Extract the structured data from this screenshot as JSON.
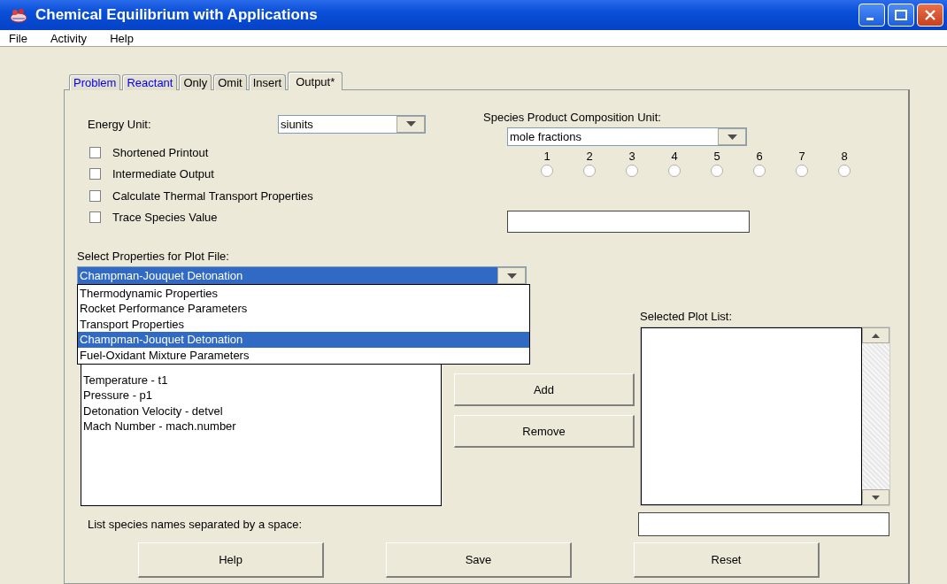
{
  "window": {
    "title": "Chemical Equilibrium with Applications"
  },
  "menu": [
    "File",
    "Activity",
    "Help"
  ],
  "tabs": [
    {
      "label": "Problem",
      "selected": false,
      "visited": true
    },
    {
      "label": "Reactant",
      "selected": false,
      "visited": true
    },
    {
      "label": "Only",
      "selected": false,
      "visited": false
    },
    {
      "label": "Omit",
      "selected": false,
      "visited": false
    },
    {
      "label": "Insert",
      "selected": false,
      "visited": false
    },
    {
      "label": "Output*",
      "selected": true,
      "visited": false
    }
  ],
  "energy_unit": {
    "label": "Energy Unit:",
    "value": "siunits"
  },
  "options": [
    {
      "label": "Shortened Printout",
      "checked": false
    },
    {
      "label": "Intermediate Output",
      "checked": false
    },
    {
      "label": "Calculate Thermal Transport Properties",
      "checked": false
    },
    {
      "label": "Trace Species Value",
      "checked": false
    }
  ],
  "composition_unit": {
    "label": "Species Product Composition Unit:",
    "value": "mole fractions"
  },
  "precision": [
    {
      "label": "1",
      "selected": false
    },
    {
      "label": "2",
      "selected": false
    },
    {
      "label": "3",
      "selected": false
    },
    {
      "label": "4",
      "selected": false
    },
    {
      "label": "5",
      "selected": false
    },
    {
      "label": "6",
      "selected": false
    },
    {
      "label": "7",
      "selected": false
    },
    {
      "label": "8",
      "selected": false
    }
  ],
  "plot_properties": {
    "label": "Select Properties for Plot File:",
    "value": "Champman-Jouquet Detonation",
    "options": [
      {
        "label": "Thermodynamic Properties",
        "selected": false
      },
      {
        "label": "Rocket Performance Parameters",
        "selected": false
      },
      {
        "label": "Transport Properties",
        "selected": false
      },
      {
        "label": "Champman-Jouquet Detonation",
        "selected": true
      },
      {
        "label": "Fuel-Oxidant Mixture Parameters",
        "selected": false
      }
    ]
  },
  "available_list": [
    "Temperature - t1",
    "Pressure - p1",
    "Detonation Velocity - detvel",
    "Mach Number - mach.number"
  ],
  "list_buttons": [
    "Add",
    "Remove"
  ],
  "selected_plot_list": {
    "label": "Selected Plot List:"
  },
  "species_names": {
    "label": "List species names separated by a space:"
  },
  "buttons": [
    "Help",
    "Save",
    "Reset"
  ]
}
